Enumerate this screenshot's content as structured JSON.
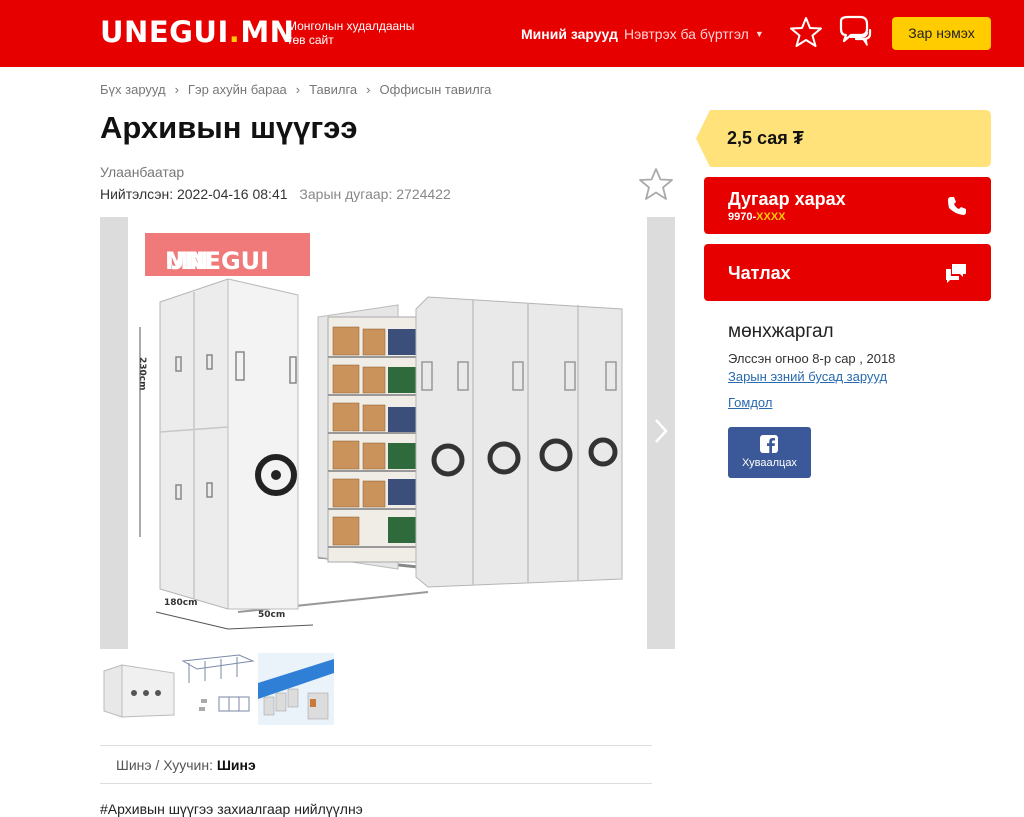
{
  "header": {
    "logo_main": "UNEGUI",
    "logo_dot": ".",
    "logo_tld": "MN",
    "tagline": "Монголын худалдааны төв сайт",
    "my_ads": "Миний зарууд",
    "login": "Нэвтрэх ба бүртгэл",
    "post_ad": "Зар нэмэх",
    "accent_color": "#e60000",
    "button_color": "#ffcc00"
  },
  "breadcrumb": [
    "Бүх зарууд",
    "Гэр ахуйн бараа",
    "Тавилга",
    "Оффисын тавилга"
  ],
  "listing": {
    "title": "Архивын шүүгээ",
    "location": "Улаанбаатар",
    "published_label": "Нийтэлсэн:",
    "published": "2022-04-16 08:41",
    "ad_number_label": "Зарын дугаар:",
    "ad_number": "2724422",
    "condition_label": "Шинэ / Хуучин:",
    "condition_value": "Шинэ",
    "description": "#Архивын  шүүгээ захиалгаар нийлүүлнэ"
  },
  "gallery": {
    "watermark_main": "UNEGUI",
    "watermark_dot": ".",
    "watermark_tld": "MN",
    "dimension_height": "230cm",
    "dimension_depth": "180cm",
    "dimension_width": "50cm",
    "thumbnails": [
      "thumb-1",
      "thumb-2",
      "thumb-3"
    ]
  },
  "sidebar": {
    "price": "2,5 сая ₮",
    "phone_label": "Дугаар харах",
    "phone_prefix": "9970-",
    "phone_mask": "XXXX",
    "chat_label": "Чатлах",
    "seller_name": "мөнхжаргал",
    "joined": "Элссэн огноо 8-р сар , 2018",
    "other_ads": "Зарын эзний бусад зарууд",
    "complain": "Гомдол",
    "share_label": "Хуваалцах"
  }
}
